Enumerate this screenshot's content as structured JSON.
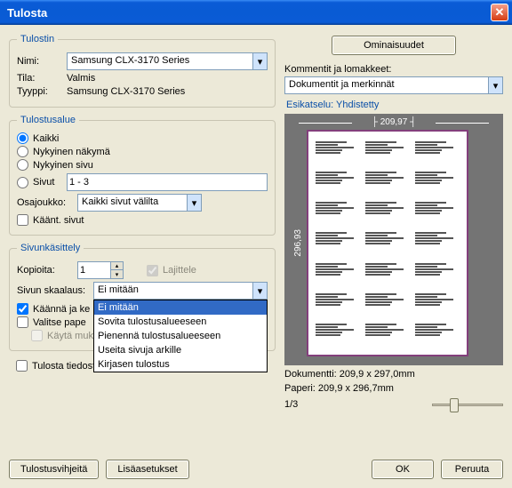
{
  "title": "Tulosta",
  "printer": {
    "legend": "Tulostin",
    "name_lbl": "Nimi:",
    "name_value": "Samsung CLX-3170 Series",
    "status_lbl": "Tila:",
    "status_value": "Valmis",
    "type_lbl": "Tyyppi:",
    "type_value": "Samsung CLX-3170 Series",
    "properties_btn": "Ominaisuudet",
    "comments_lbl": "Kommentit ja lomakkeet:",
    "comments_value": "Dokumentit ja merkinnät"
  },
  "range": {
    "legend": "Tulostusalue",
    "opt_all": "Kaikki",
    "opt_current_view": "Nykyinen näkymä",
    "opt_current_page": "Nykyinen sivu",
    "opt_pages": "Sivut",
    "pages_value": "1 - 3",
    "subset_lbl": "Osajoukko:",
    "subset_value": "Kaikki sivut välilta",
    "reverse_pages": "Käänt. sivut"
  },
  "handling": {
    "legend": "Sivunkäsittely",
    "copies_lbl": "Kopioita:",
    "copies_value": "1",
    "collate": "Lajittele",
    "scale_lbl": "Sivun skaalaus:",
    "scale_value": "Ei mitään",
    "scale_options": [
      "Ei mitään",
      "Sovita tulostusalueeseen",
      "Pienennä tulostusalueeseen",
      "Useita sivuja arkille",
      "Kirjasen tulostus"
    ],
    "rotate_center": "Käännä ja ke",
    "choose_paper": "Valitse pape",
    "custom_paper": "Käytä mukautettua paperikokoa tarvitaessa"
  },
  "preview": {
    "header": "Esikatselu: Yhdistetty",
    "width": "209,97",
    "height": "296,93",
    "doc": "Dokumentti: 209,9 x 297,0mm",
    "paper": "Paperi: 209,9 x 296,7mm",
    "page_num": "1/3"
  },
  "print_to_file": "Tulosta tiedostoon",
  "tips_btn": "Tulostusvihjeitä",
  "more_btn": "Lisäasetukset",
  "ok_btn": "OK",
  "cancel_btn": "Peruuta"
}
